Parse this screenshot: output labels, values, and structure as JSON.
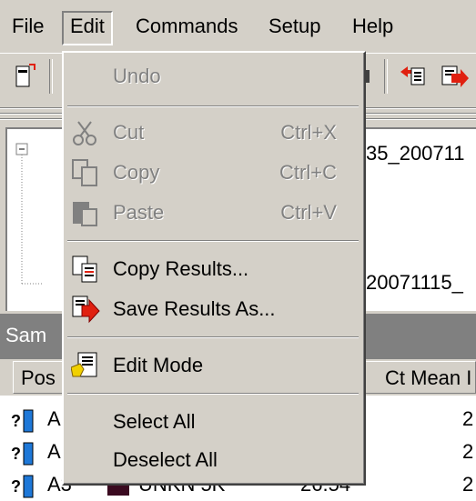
{
  "menubar": {
    "items": [
      "File",
      "Edit",
      "Commands",
      "Setup",
      "Help"
    ]
  },
  "tree": {
    "item1": "35_200711",
    "item2": "20071115_"
  },
  "samples": {
    "tab_label": "Sam"
  },
  "grid": {
    "headers": {
      "pos": "Pos",
      "ct_mean": "Ct Mean I"
    },
    "rows": [
      {
        "pos": "A",
        "ct_mean": "2"
      },
      {
        "pos": "A",
        "ct_mean": "2"
      },
      {
        "pos": "A3",
        "name": "UNKN 5K",
        "ct": "26.54",
        "ct_mean": "2"
      }
    ]
  },
  "edit_menu": {
    "undo": "Undo",
    "cut": "Cut",
    "cut_shortcut": "Ctrl+X",
    "copy": "Copy",
    "copy_shortcut": "Ctrl+C",
    "paste": "Paste",
    "paste_shortcut": "Ctrl+V",
    "copy_results": "Copy Results...",
    "save_results": "Save Results As...",
    "edit_mode": "Edit Mode",
    "select_all": "Select All",
    "deselect_all": "Deselect All"
  },
  "colors": {
    "face": "#d4d0c8",
    "shadow": "#808080",
    "highlight": "#ffffff",
    "arrow_red": "#e02010",
    "well_blue": "#1e78d8"
  }
}
